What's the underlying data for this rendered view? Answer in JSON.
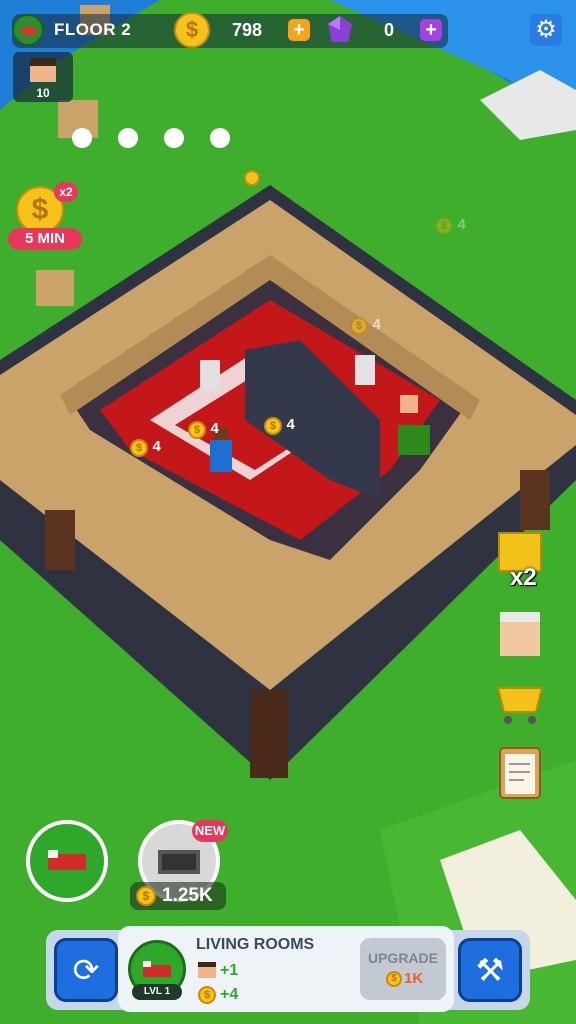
{
  "hud": {
    "floor_label": "FLOOR 2",
    "coins": "798",
    "gems": "0",
    "workers": "10"
  },
  "bonus": {
    "multiplier": "x2",
    "duration": "5 MIN"
  },
  "floating_coins": [
    "4",
    "4",
    "4",
    "4",
    "4"
  ],
  "side_buttons": {
    "booster_label": "x2"
  },
  "build": {
    "new_badge": "NEW",
    "price": "1.25K"
  },
  "room_panel": {
    "title": "LIVING ROOMS",
    "level": "LVL 1",
    "workers_bonus": "+1",
    "coins_bonus": "+4",
    "upgrade_label": "UPGRADE",
    "upgrade_cost": "1K"
  },
  "colors": {
    "grass": "#3fae2c",
    "water": "#1f7fd6",
    "wood": "#c9a36a",
    "stone": "#2f3240",
    "carpet": "#c4171a",
    "button_blue": "#1f6ee0"
  }
}
